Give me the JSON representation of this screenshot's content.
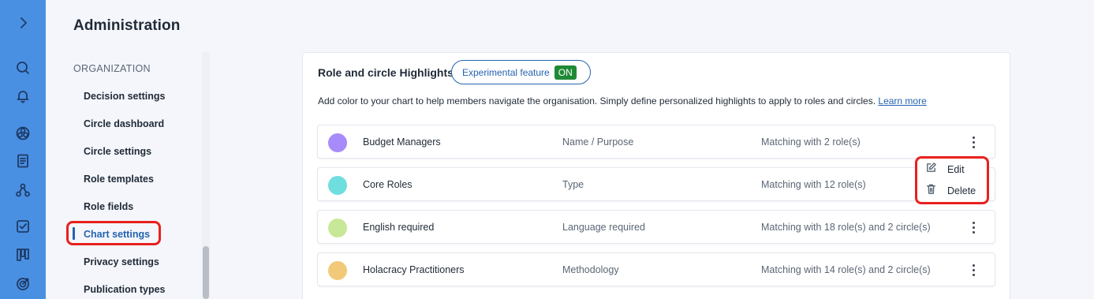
{
  "page": {
    "title": "Administration"
  },
  "nav_rail": {
    "color": "#4a90e2",
    "items": [
      "chevron-right-icon",
      "search-icon",
      "bell-icon",
      "chart-circles-icon",
      "document-icon",
      "roles-icon",
      "checklist-icon",
      "kanban-icon",
      "target-icon"
    ]
  },
  "sidebar": {
    "section": "ORGANIZATION",
    "items": [
      {
        "label": "Decision settings"
      },
      {
        "label": "Circle dashboard"
      },
      {
        "label": "Circle settings"
      },
      {
        "label": "Role templates"
      },
      {
        "label": "Role fields"
      },
      {
        "label": "Chart settings",
        "active": true
      },
      {
        "label": "Privacy settings"
      },
      {
        "label": "Publication types"
      }
    ]
  },
  "highlights": {
    "title": "Role and circle Highlights",
    "experimental_label": "Experimental feature",
    "toggle": "ON",
    "description": "Add color to your chart to help members navigate the organisation. Simply define personalized highlights to apply to roles and circles.",
    "learn_more": "Learn more",
    "rows": [
      {
        "name": "Budget Managers",
        "criterion": "Name / Purpose",
        "match": "Matching with 2 role(s)",
        "color": "#a78bfa"
      },
      {
        "name": "Core Roles",
        "criterion": "Type",
        "match": "Matching with 12 role(s)",
        "color": "#6fdede"
      },
      {
        "name": "English required",
        "criterion": "Language required",
        "match": "Matching with 18 role(s) and 2 circle(s)",
        "color": "#c8e899"
      },
      {
        "name": "Holacracy Practitioners",
        "criterion": "Methodology",
        "match": "Matching with 14 role(s) and 2 circle(s)",
        "color": "#f2c978"
      }
    ]
  },
  "context_menu": {
    "items": [
      {
        "label": "Edit",
        "icon": "edit-icon"
      },
      {
        "label": "Delete",
        "icon": "trash-icon"
      }
    ]
  }
}
